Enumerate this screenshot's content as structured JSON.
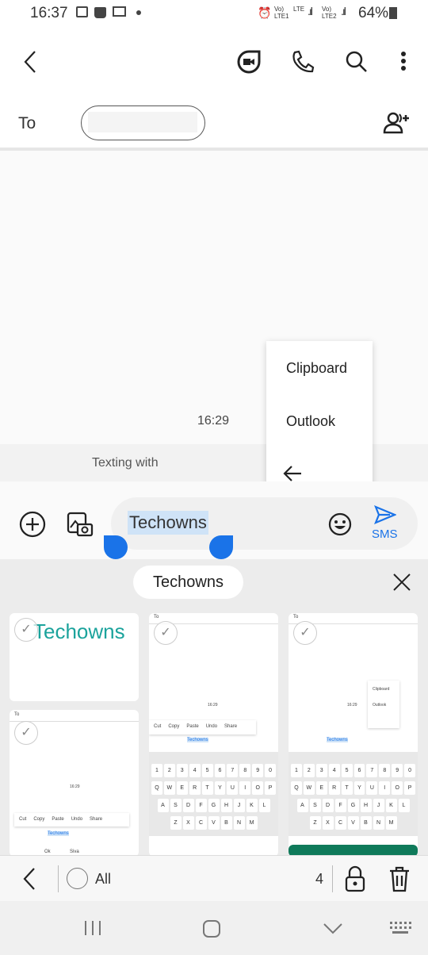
{
  "status": {
    "time": "16:37",
    "battery": "64%",
    "net1": "Vo) LTE1",
    "net2": "LTE",
    "net3": "Vo) LTE2"
  },
  "toolbar": {
    "icons": [
      "back-icon",
      "video-call-icon",
      "phone-icon",
      "search-icon",
      "more-icon"
    ]
  },
  "recipient": {
    "label": "To",
    "value": ""
  },
  "conversation": {
    "timestamp": "16:29",
    "texting_with": "Texting with"
  },
  "popup": {
    "items": [
      "Clipboard",
      "Outlook"
    ]
  },
  "composer": {
    "text": "Techowns",
    "send_label": "SMS",
    "accent": "#1a73e8"
  },
  "clipboard": {
    "chip": "Techowns",
    "first_item_text": "Techowns",
    "thumb_to": "To",
    "thumb_time": "16:29",
    "thumb_menu": [
      "Cut",
      "Copy",
      "Paste",
      "Undo",
      "Share"
    ],
    "thumb_popup": [
      "Clipboard",
      "Outlook"
    ],
    "thumb_partial": [
      "Ok",
      "Siva"
    ],
    "key_rows": [
      [
        "1",
        "2",
        "3",
        "4",
        "5",
        "6",
        "7",
        "8",
        "9",
        "0"
      ],
      [
        "Q",
        "W",
        "E",
        "R",
        "T",
        "Y",
        "U",
        "I",
        "O",
        "P"
      ],
      [
        "A",
        "S",
        "D",
        "F",
        "G",
        "H",
        "J",
        "K",
        "L"
      ],
      [
        "Z",
        "X",
        "C",
        "V",
        "B",
        "N",
        "M"
      ]
    ]
  },
  "bottom": {
    "all_label": "All",
    "count": "4"
  }
}
